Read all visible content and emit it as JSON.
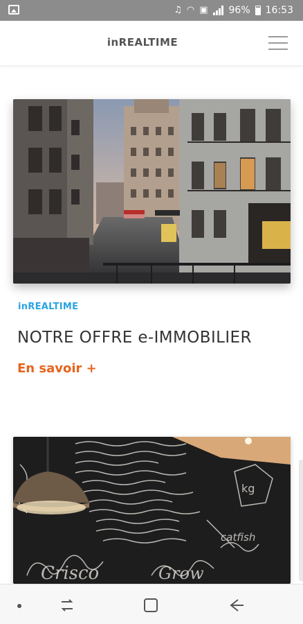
{
  "status_bar": {
    "battery": "96%",
    "time": "16:53",
    "icons": [
      "image-icon",
      "volume-icon",
      "wifi-icon",
      "nfc-icon",
      "signal-icon",
      "battery-icon"
    ]
  },
  "header": {
    "brand": "inREALTIME",
    "menu_icon": "hamburger-icon"
  },
  "cards": [
    {
      "image": "paris-street-photo",
      "kicker": "inREALTIME",
      "title": "NOTRE OFFRE e-IMMOBILIER",
      "link": "En savoir +"
    },
    {
      "image": "chalkboard-restaurant-photo"
    }
  ],
  "nav_bar": {
    "icons": [
      "dot-icon",
      "recent-apps-icon",
      "home-icon",
      "back-icon"
    ]
  },
  "colors": {
    "accent_blue": "#29a3e3",
    "accent_orange": "#e8631c",
    "status_bar": "#8c8c8c"
  }
}
